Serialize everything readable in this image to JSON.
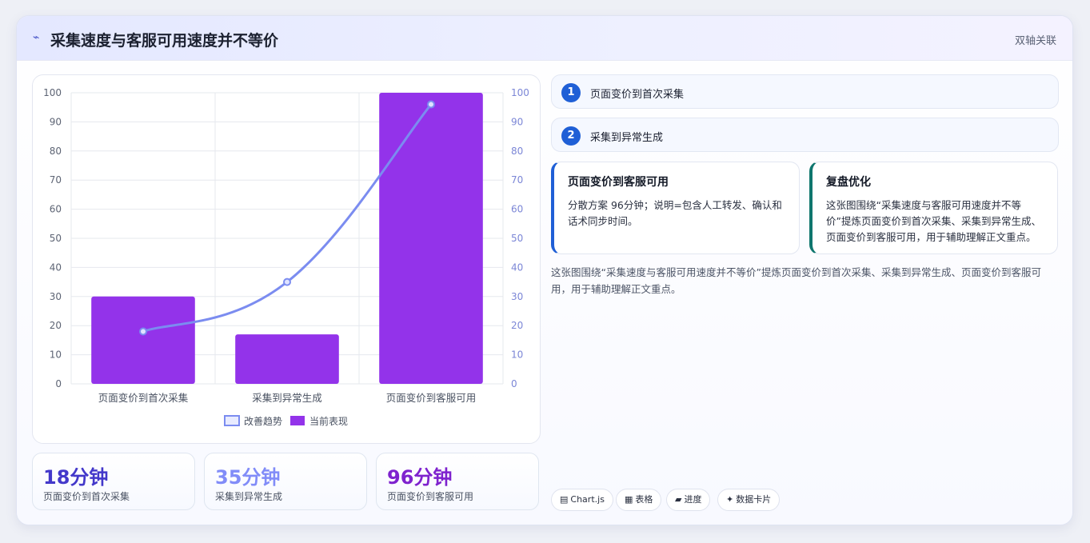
{
  "header": {
    "icon": "trend-icon",
    "title": "采集速度与客服可用速度并不等价",
    "tag": "双轴关联"
  },
  "chart_data": {
    "type": "bar",
    "categories": [
      "页面变价到首次采集",
      "采集到异常生成",
      "页面变价到客服可用"
    ],
    "series": [
      {
        "name": "改善趋势",
        "type": "line",
        "axis": "right",
        "color": "#7b8cf0",
        "values": [
          18,
          35,
          96
        ]
      },
      {
        "name": "当前表现",
        "type": "bar",
        "axis": "left",
        "color": "#9333ea",
        "values": [
          30,
          17,
          100
        ]
      }
    ],
    "ylim": [
      0,
      100
    ],
    "y2lim": [
      0,
      100
    ],
    "yticks": [
      0,
      10,
      20,
      30,
      40,
      50,
      60,
      70,
      80,
      90,
      100
    ],
    "legend": "bottom",
    "grid": true
  },
  "stats": [
    {
      "value": "18分钟",
      "label": "页面变价到首次采集",
      "color": "#4338ca"
    },
    {
      "value": "35分钟",
      "label": "采集到异常生成",
      "color": "#818cf8"
    },
    {
      "value": "96分钟",
      "label": "页面变价到客服可用",
      "color": "#7e22ce"
    }
  ],
  "steps": [
    {
      "num": "1",
      "label": "页面变价到首次采集"
    },
    {
      "num": "2",
      "label": "采集到异常生成"
    }
  ],
  "cards": [
    {
      "title": "页面变价到客服可用",
      "body": "分散方案 96分钟；说明=包含人工转发、确认和话术同步时间。",
      "accent": "#1f5fd6"
    },
    {
      "title": "复盘优化",
      "body": "这张图围绕“采集速度与客服可用速度并不等价”提炼页面变价到首次采集、采集到异常生成、页面变价到客服可用，用于辅助理解正文重点。",
      "accent": "#0f766e"
    }
  ],
  "description": "这张图围绕“采集速度与客服可用速度并不等价”提炼页面变价到首次采集、采集到异常生成、页面变价到客服可用，用于辅助理解正文重点。",
  "chips": [
    {
      "icon": "▤",
      "label": "Chart.js"
    },
    {
      "icon": "▦",
      "label": "表格"
    },
    {
      "icon": "▰",
      "label": "进度"
    },
    {
      "icon": "✦",
      "label": "数据卡片"
    }
  ]
}
